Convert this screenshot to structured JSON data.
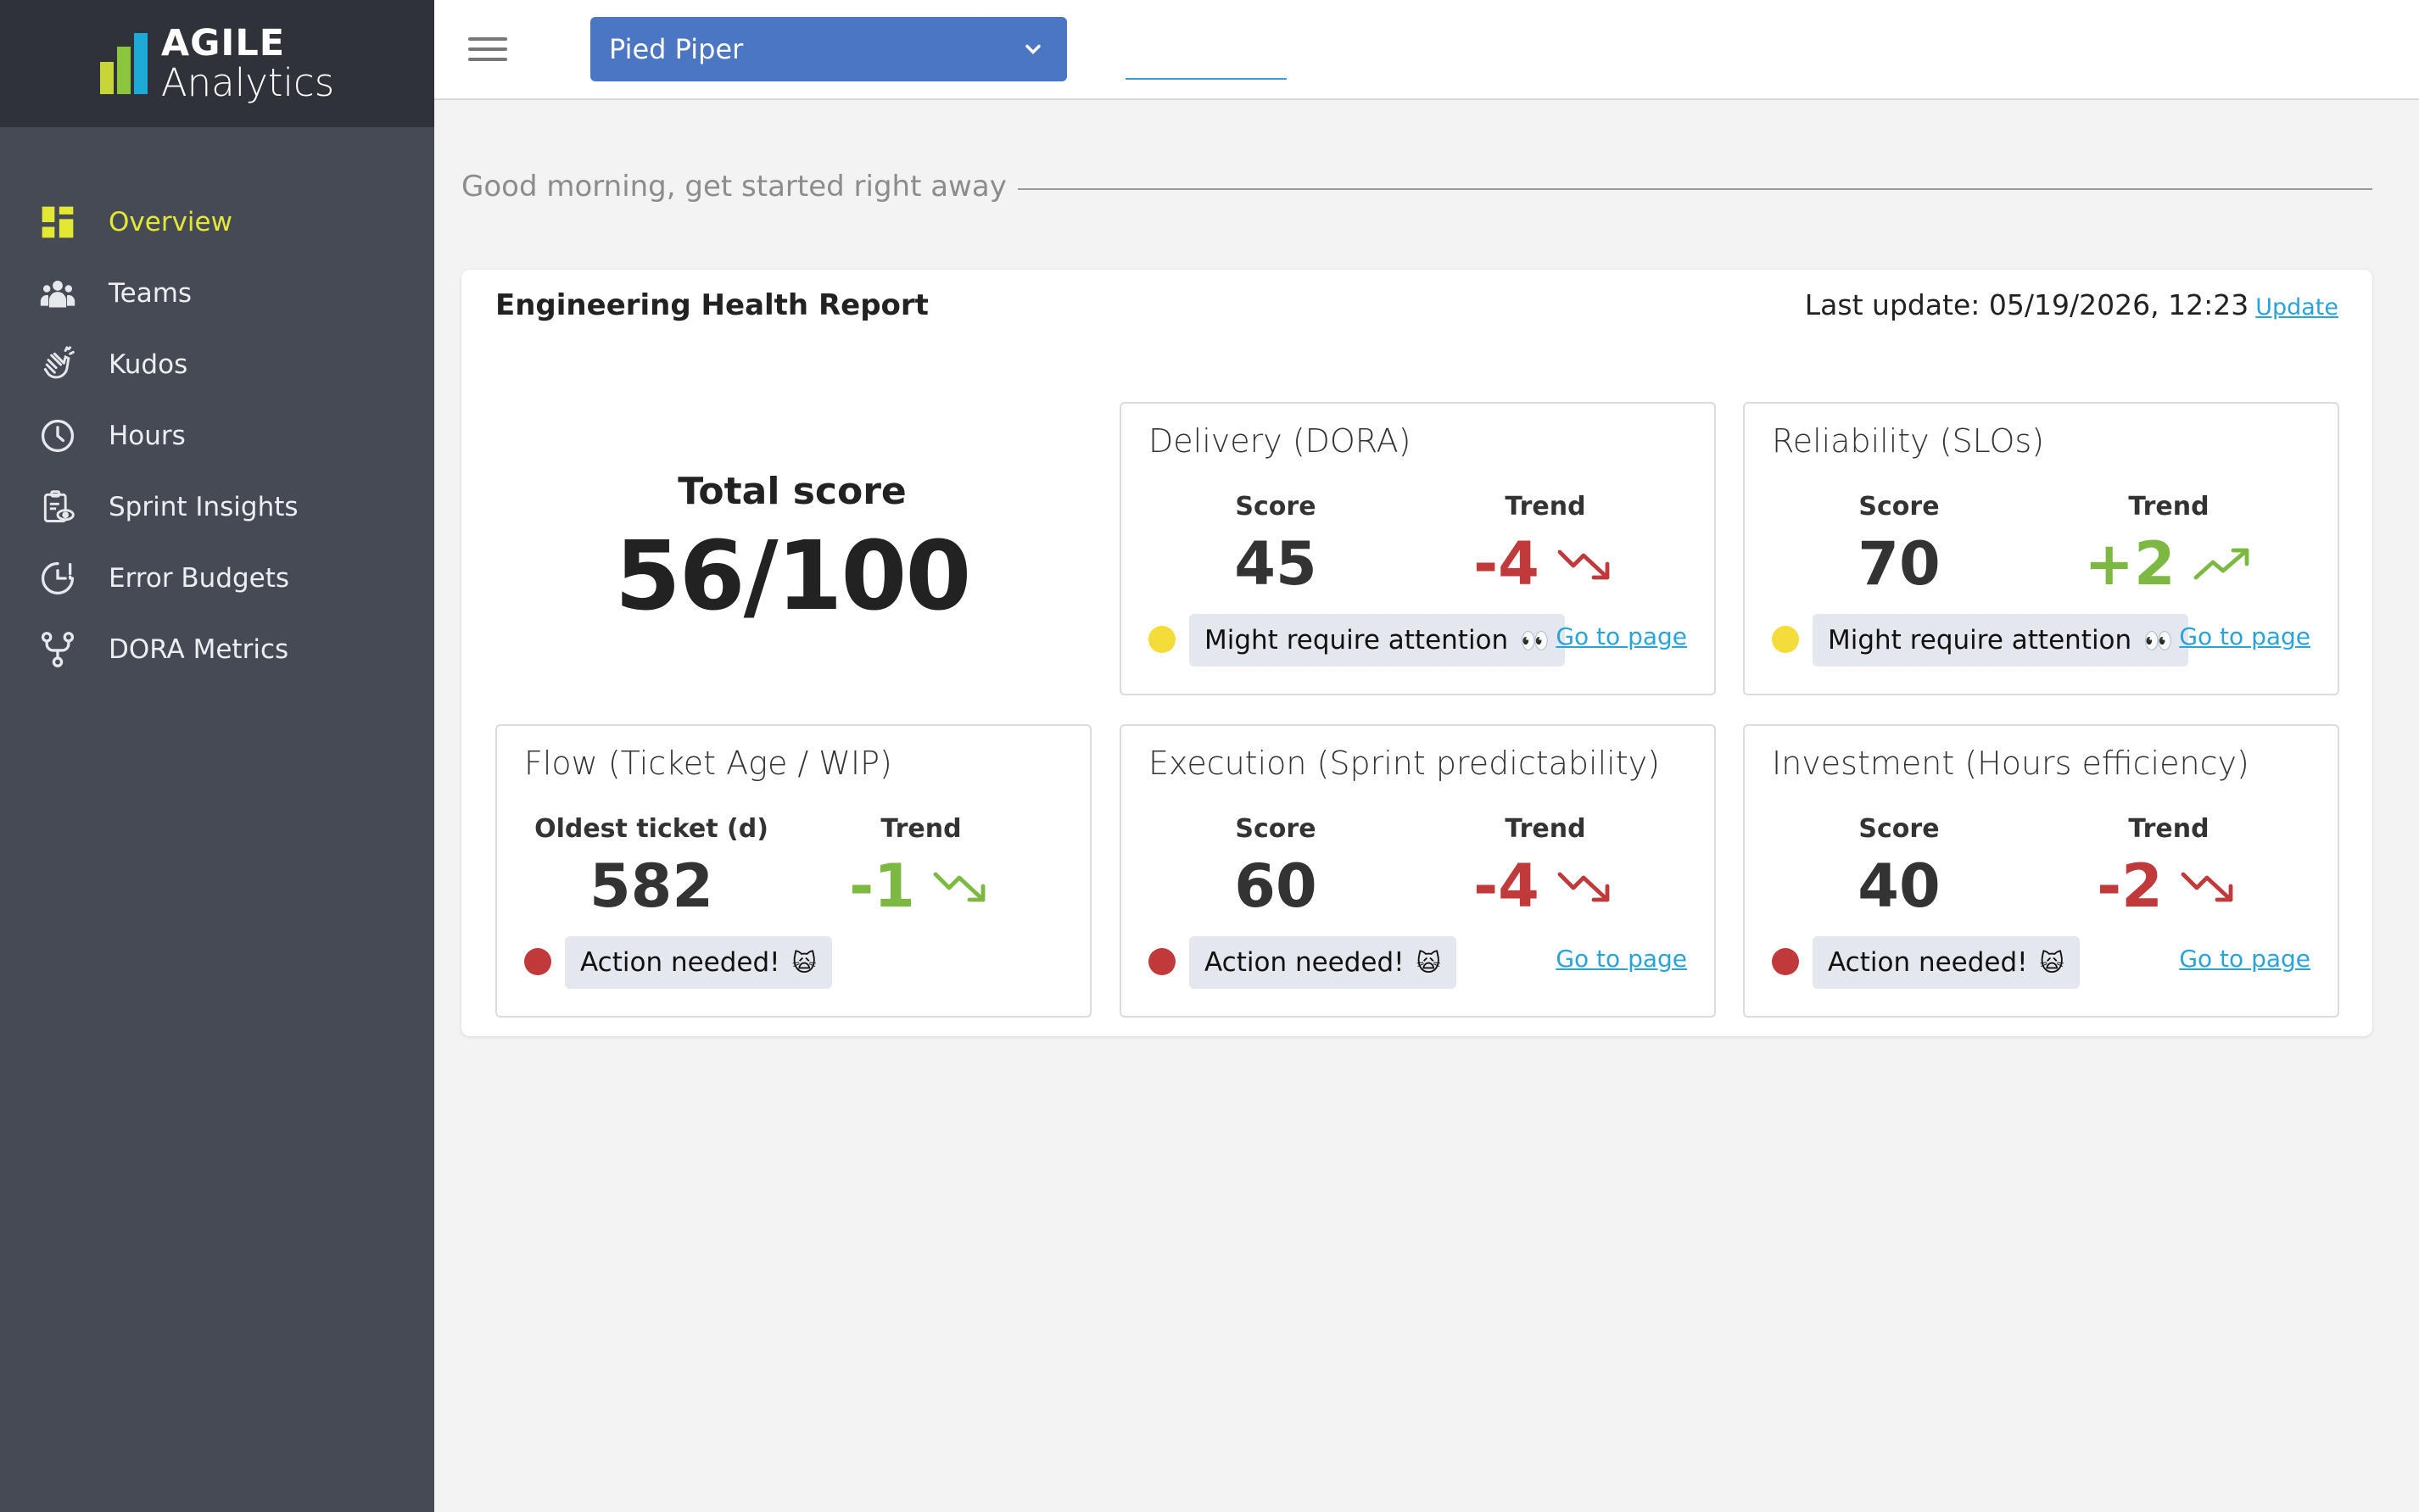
{
  "app": {
    "logo_line1": "AGILE",
    "logo_line2": "Analytics",
    "logo_colors": [
      "#c8d536",
      "#8cc63f",
      "#1fa9d6"
    ]
  },
  "sidebar": {
    "items": [
      {
        "label": "Overview",
        "icon": "grid-icon",
        "active": true
      },
      {
        "label": "Teams",
        "icon": "people-icon",
        "active": false
      },
      {
        "label": "Kudos",
        "icon": "clap-icon",
        "active": false
      },
      {
        "label": "Hours",
        "icon": "clock-icon",
        "active": false
      },
      {
        "label": "Sprint Insights",
        "icon": "clipboard-eye-icon",
        "active": false
      },
      {
        "label": "Error Budgets",
        "icon": "gauge-icon",
        "active": false
      },
      {
        "label": "DORA Metrics",
        "icon": "branch-icon",
        "active": false
      }
    ],
    "active_color": "#e3e835"
  },
  "topbar": {
    "org_select_value": "Pied Piper"
  },
  "greeting": "Good morning, get started right away",
  "report": {
    "title": "Engineering Health Report",
    "last_update_label": "Last update: 05/19/2026, 12:23",
    "update_link": "Update",
    "total_label": "Total score",
    "total_value": "56/100",
    "cards": [
      {
        "title": "Delivery (DORA)",
        "score_label": "Score",
        "score": "45",
        "trend_label": "Trend",
        "trend": "-4",
        "trend_direction": "down",
        "status_color": "#f4dc3a",
        "status": "Might require attention",
        "status_emoji": "👀",
        "link": "Go to page"
      },
      {
        "title": "Reliability (SLOs)",
        "score_label": "Score",
        "score": "70",
        "trend_label": "Trend",
        "trend": "+2",
        "trend_direction": "up",
        "status_color": "#f4dc3a",
        "status": "Might require attention",
        "status_emoji": "👀",
        "link": "Go to page"
      },
      {
        "title": "Flow (Ticket Age / WIP)",
        "score_label": "Oldest ticket (d)",
        "score": "582",
        "trend_label": "Trend",
        "trend": "-1",
        "trend_direction": "down-good",
        "status_color": "#c0393b",
        "status": "Action needed!",
        "status_emoji": "🙀",
        "link": ""
      },
      {
        "title": "Execution (Sprint predictability)",
        "score_label": "Score",
        "score": "60",
        "trend_label": "Trend",
        "trend": "-4",
        "trend_direction": "down",
        "status_color": "#c0393b",
        "status": "Action needed!",
        "status_emoji": "🙀",
        "link": "Go to page"
      },
      {
        "title": "Investment (Hours efficiency)",
        "score_label": "Score",
        "score": "40",
        "trend_label": "Trend",
        "trend": "-2",
        "trend_direction": "down",
        "status_color": "#c0393b",
        "status": "Action needed!",
        "status_emoji": "🙀",
        "link": "Go to page"
      }
    ],
    "colors": {
      "negative": "#c0393b",
      "positive": "#7db842",
      "link": "#2aa3d9"
    }
  }
}
